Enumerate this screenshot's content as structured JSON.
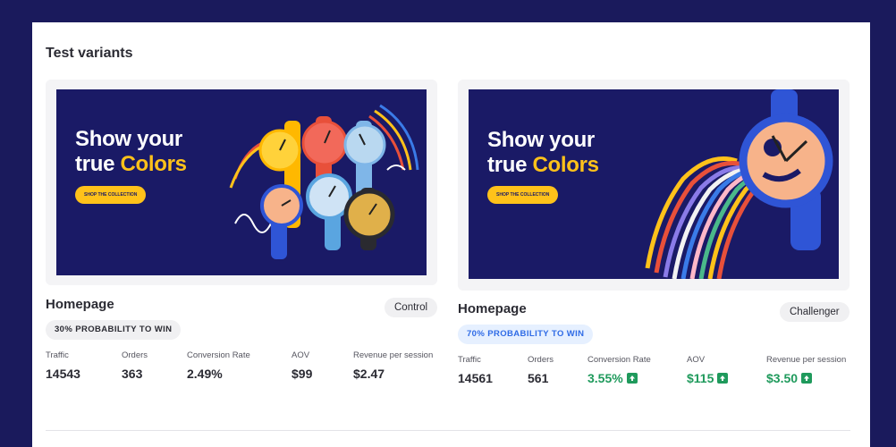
{
  "panel": {
    "title": "Test variants"
  },
  "variants": [
    {
      "name": "Homepage",
      "role": "Control",
      "probability": "30% PROBABILITY TO WIN",
      "banner": {
        "line1": "Show your",
        "line2a": "true ",
        "line2b": "Colors",
        "cta": "SHOP THE COLLECTION"
      },
      "metrics": [
        {
          "label": "Traffic",
          "value": "14543"
        },
        {
          "label": "Orders",
          "value": "363"
        },
        {
          "label": "Conversion Rate",
          "value": "2.49%"
        },
        {
          "label": "AOV",
          "value": "$99"
        },
        {
          "label": "Revenue per session",
          "value": "$2.47"
        }
      ]
    },
    {
      "name": "Homepage",
      "role": "Challenger",
      "probability": "70% PROBABILITY TO WIN",
      "banner": {
        "line1": "Show your",
        "line2a": "true ",
        "line2b": "Colors",
        "cta": "SHOP THE COLLECTION"
      },
      "metrics": [
        {
          "label": "Traffic",
          "value": "14561"
        },
        {
          "label": "Orders",
          "value": "561"
        },
        {
          "label": "Conversion Rate",
          "value": "3.55%"
        },
        {
          "label": "AOV",
          "value": "$115"
        },
        {
          "label": "Revenue per session",
          "value": "$3.50"
        }
      ]
    }
  ],
  "colors": {
    "background": "#1a1a5c",
    "banner": "#1a1a66",
    "accent": "#ffc21a",
    "positive": "#1f9a5c",
    "challenger_pill": "#2f6be6"
  },
  "icons": {
    "trend_up": "arrow-up-icon"
  }
}
